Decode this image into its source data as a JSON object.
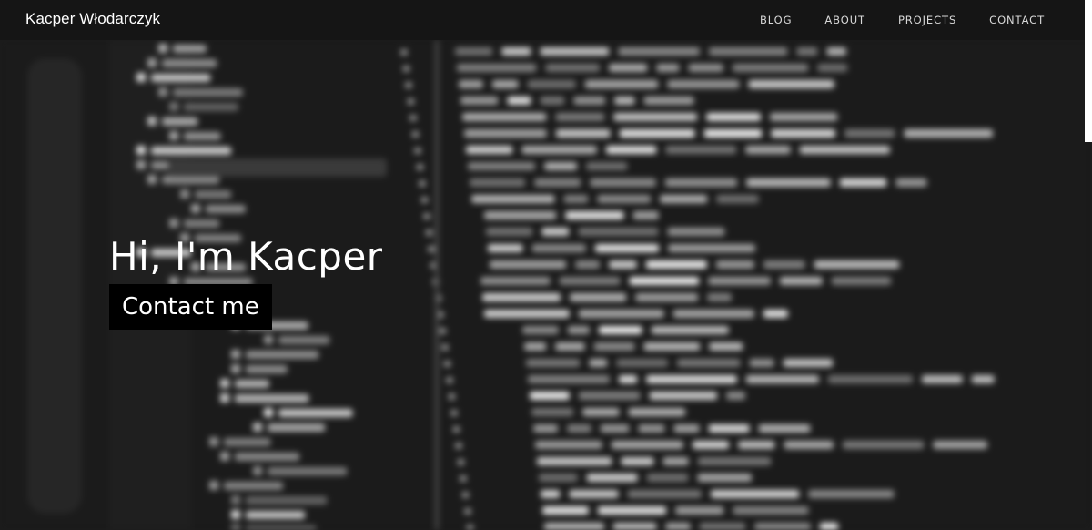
{
  "nav": {
    "brand": "Kacper Włodarczyk",
    "links": [
      {
        "label": "BLOG"
      },
      {
        "label": "ABOUT"
      },
      {
        "label": "PROJECTS"
      },
      {
        "label": "CONTACT"
      }
    ]
  },
  "hero": {
    "title": "Hi, I'm Kacper",
    "cta_label": "Contact me",
    "background": "blurred-code-editor-photo"
  },
  "colors": {
    "nav_bg": "#151515",
    "hero_bg": "#1c1c1c",
    "cta_bg": "#000000",
    "text": "#ffffff"
  }
}
